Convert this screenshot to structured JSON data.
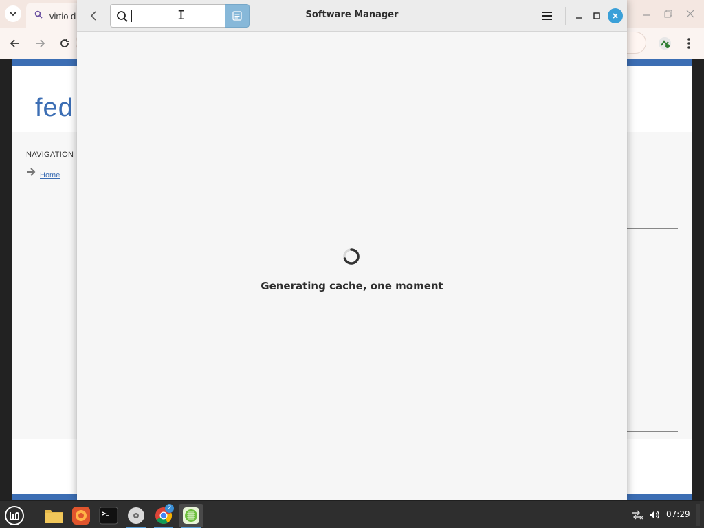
{
  "browser": {
    "tab_title": "virtio d",
    "page": {
      "logo_text": "fed",
      "nav_heading": "NAVIGATION",
      "nav_home": "Home"
    },
    "icons": {
      "tab_list": "chevron-down-icon",
      "tab_favicon": "search-icon",
      "back": "arrow-left-icon",
      "forward": "arrow-right-icon",
      "reload": "reload-icon",
      "extension": "extension-icon",
      "menu": "kebab-menu-icon"
    }
  },
  "software_manager": {
    "title": "Software Manager",
    "search": {
      "value": "",
      "placeholder": ""
    },
    "status_text": "Generating cache, one moment",
    "icons": {
      "back": "chevron-left-icon",
      "search": "search-icon",
      "search_toggle": "list-icon",
      "menu": "hamburger-menu-icon",
      "minimize": "minimize-icon",
      "maximize": "maximize-icon",
      "close": "close-icon",
      "spinner": "loading-spinner-icon"
    },
    "colors": {
      "accent": "#3aa0d8",
      "toggle_active": "#87b8d9"
    }
  },
  "taskbar": {
    "clock": "07:29",
    "chrome_badge": "2",
    "items": [
      {
        "name": "mint-menu"
      },
      {
        "name": "files"
      },
      {
        "name": "firefox"
      },
      {
        "name": "terminal"
      },
      {
        "name": "disk-app"
      },
      {
        "name": "chrome"
      },
      {
        "name": "software-manager"
      }
    ]
  }
}
